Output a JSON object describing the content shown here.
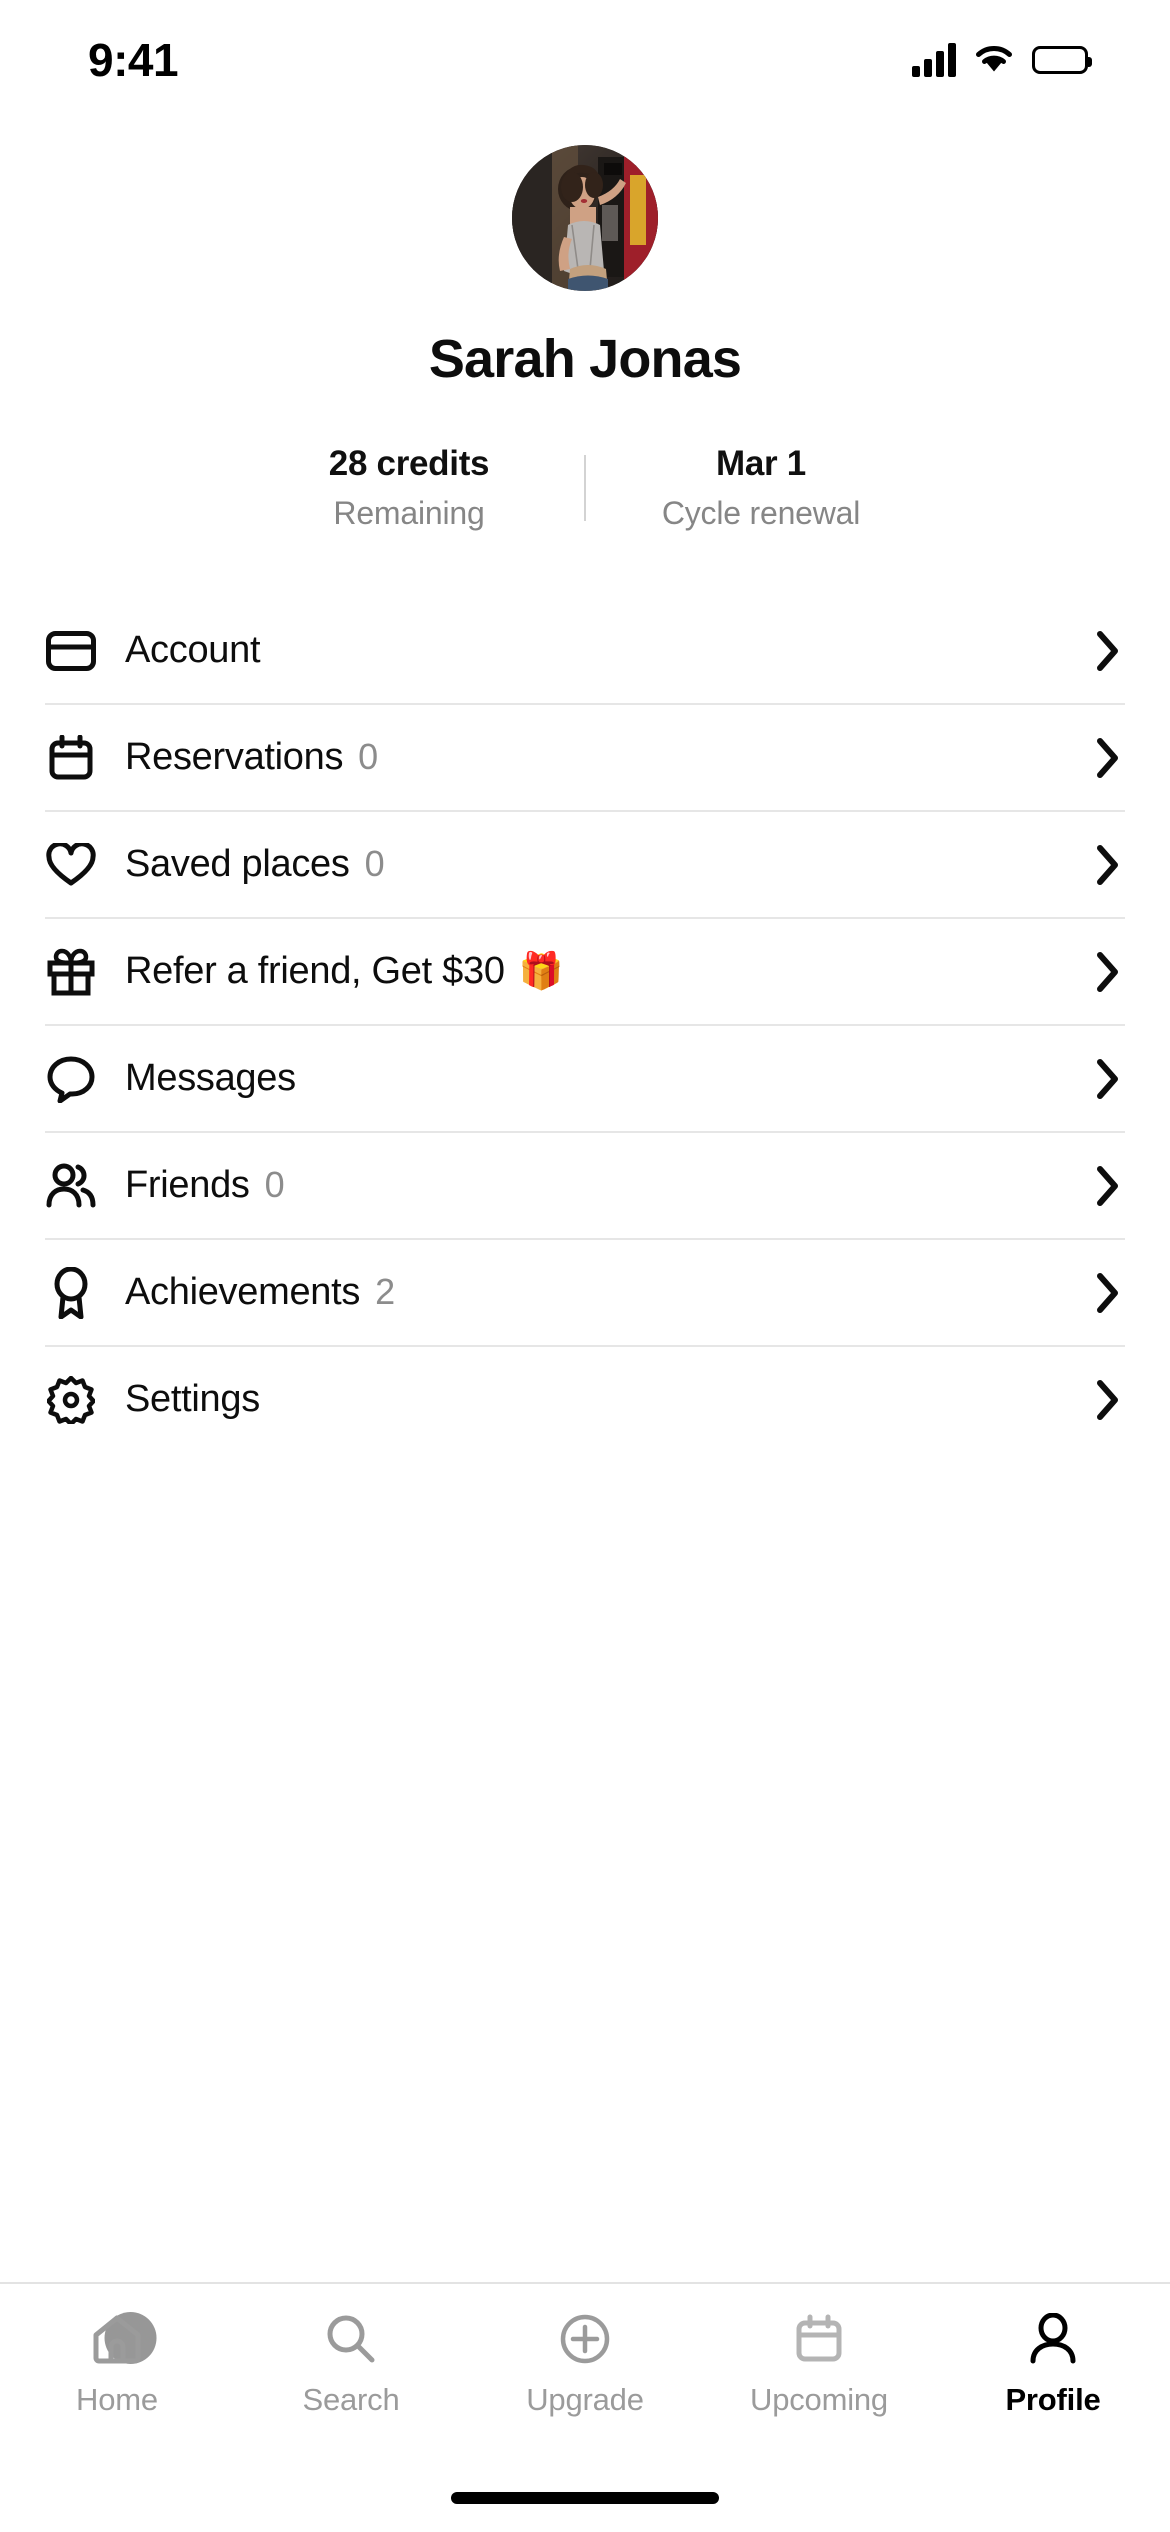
{
  "status_bar": {
    "time": "9:41",
    "signal_icon": "cellular-signal-icon",
    "wifi_icon": "wifi-icon",
    "battery_icon": "battery-full-icon"
  },
  "profile": {
    "avatar_alt": "user-avatar-photo",
    "name": "Sarah Jonas"
  },
  "stats": [
    {
      "value": "28 credits",
      "label": "Remaining"
    },
    {
      "value": "Mar 1",
      "label": "Cycle renewal"
    }
  ],
  "menu": [
    {
      "icon": "credit-card-icon",
      "label": "Account",
      "count": "",
      "emoji": ""
    },
    {
      "icon": "calendar-icon",
      "label": "Reservations",
      "count": "0",
      "emoji": ""
    },
    {
      "icon": "heart-icon",
      "label": "Saved places",
      "count": "0",
      "emoji": ""
    },
    {
      "icon": "gift-icon",
      "label": "Refer a friend, Get $30",
      "count": "",
      "emoji": "🎁"
    },
    {
      "icon": "chat-bubble-icon",
      "label": "Messages",
      "count": "",
      "emoji": ""
    },
    {
      "icon": "people-icon",
      "label": "Friends",
      "count": "0",
      "emoji": ""
    },
    {
      "icon": "award-medal-icon",
      "label": "Achievements",
      "count": "2",
      "emoji": ""
    },
    {
      "icon": "gear-icon",
      "label": "Settings",
      "count": "",
      "emoji": ""
    }
  ],
  "chevron_icon": "chevron-right-icon",
  "tabs": [
    {
      "icon": "home-icon",
      "label": "Home",
      "active": false
    },
    {
      "icon": "search-icon",
      "label": "Search",
      "active": false
    },
    {
      "icon": "plus-circle-icon",
      "label": "Upgrade",
      "active": false
    },
    {
      "icon": "calendar-icon",
      "label": "Upcoming",
      "active": false
    },
    {
      "icon": "person-icon",
      "label": "Profile",
      "active": true
    }
  ],
  "colors": {
    "background": "#ffffff",
    "text_primary": "#0d0d0d",
    "text_muted": "#8c8c8c",
    "divider": "#e6e6e6",
    "tab_inactive": "#9b9b9b",
    "tab_active": "#000000"
  }
}
